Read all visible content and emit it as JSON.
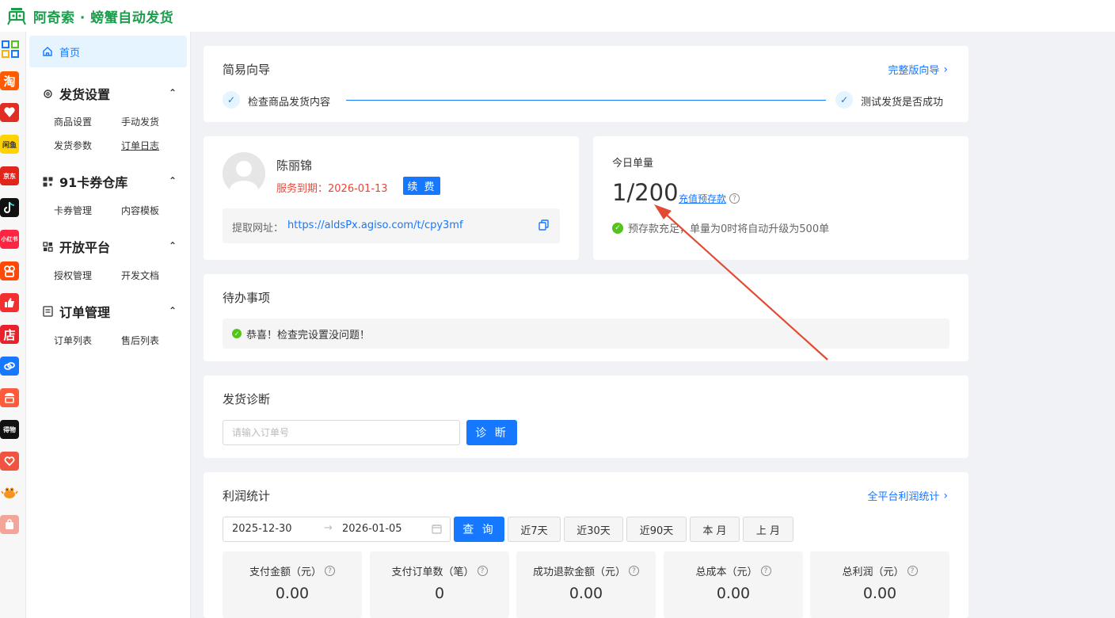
{
  "header": {
    "brand": "阿奇索 · 螃蟹自动发货",
    "logo_icon": "crab-logo-icon",
    "brand_color": "#1b9d4c"
  },
  "rail": {
    "items": [
      {
        "name": "grid-apps-icon",
        "label": ""
      },
      {
        "name": "taobao-icon",
        "label": "淘"
      },
      {
        "name": "pinduoduo-icon",
        "label": ""
      },
      {
        "name": "weidian-icon",
        "label": "闲鱼"
      },
      {
        "name": "jd-icon",
        "label": "京东"
      },
      {
        "name": "douyin-icon",
        "label": ""
      },
      {
        "name": "xiaohongshu-icon",
        "label": "小红书"
      },
      {
        "name": "kuaishou-icon",
        "label": ""
      },
      {
        "name": "thumbs-up-icon",
        "label": ""
      },
      {
        "name": "dian-shop-icon",
        "label": "店"
      },
      {
        "name": "link-icon",
        "label": ""
      },
      {
        "name": "shop-awning-icon",
        "label": ""
      },
      {
        "name": "dewu-icon",
        "label": "得物"
      },
      {
        "name": "heart-bag-icon",
        "label": ""
      },
      {
        "name": "crab-mascot-icon",
        "label": ""
      },
      {
        "name": "bag-icon",
        "label": ""
      }
    ]
  },
  "nav": {
    "home": "首页",
    "groups": [
      {
        "title": "发货设置",
        "items": [
          "商品设置",
          "手动发货",
          "发货参数",
          "订单日志"
        ]
      },
      {
        "title": "91卡券仓库",
        "items": [
          "卡券管理",
          "内容模板"
        ]
      },
      {
        "title": "开放平台",
        "items": [
          "授权管理",
          "开发文档"
        ]
      },
      {
        "title": "订单管理",
        "items": [
          "订单列表",
          "售后列表"
        ]
      }
    ]
  },
  "guide": {
    "title": "简易向导",
    "full_link": "完整版向导",
    "step1": "检查商品发货内容",
    "step2": "测试发货是否成功"
  },
  "account": {
    "name": "陈丽锦",
    "expire": "服务到期：2026-01-13",
    "renew": "续 费",
    "url_label": "提取网址：",
    "url": "https://aldsPx.agiso.com/t/cpy3mf"
  },
  "today": {
    "title": "今日单量",
    "count": "1/200",
    "recharge": "充值预存款",
    "notice": "预存款充足，单量为0时将自动升级为500单"
  },
  "todo": {
    "title": "待办事项",
    "message": "恭喜！检查完设置没问题！"
  },
  "diagnosis": {
    "title": "发货诊断",
    "placeholder": "请输入订单号",
    "button": "诊 断"
  },
  "profit": {
    "title": "利润统计",
    "all_link": "全平台利润统计",
    "date_start": "2025-12-30",
    "date_end": "2026-01-05",
    "query": "查 询",
    "ranges": [
      "近7天",
      "近30天",
      "近90天",
      "本 月",
      "上 月"
    ],
    "stats": [
      {
        "label": "支付金额（元）",
        "value": "0.00"
      },
      {
        "label": "支付订单数（笔）",
        "value": "0"
      },
      {
        "label": "成功退款金额（元）",
        "value": "0.00"
      },
      {
        "label": "总成本（元）",
        "value": "0.00"
      },
      {
        "label": "总利润（元）",
        "value": "0.00"
      }
    ]
  },
  "colors": {
    "primary": "#1677ff",
    "success": "#52c41a",
    "danger": "#e8473a",
    "annotation_arrow": "#e24a33"
  }
}
